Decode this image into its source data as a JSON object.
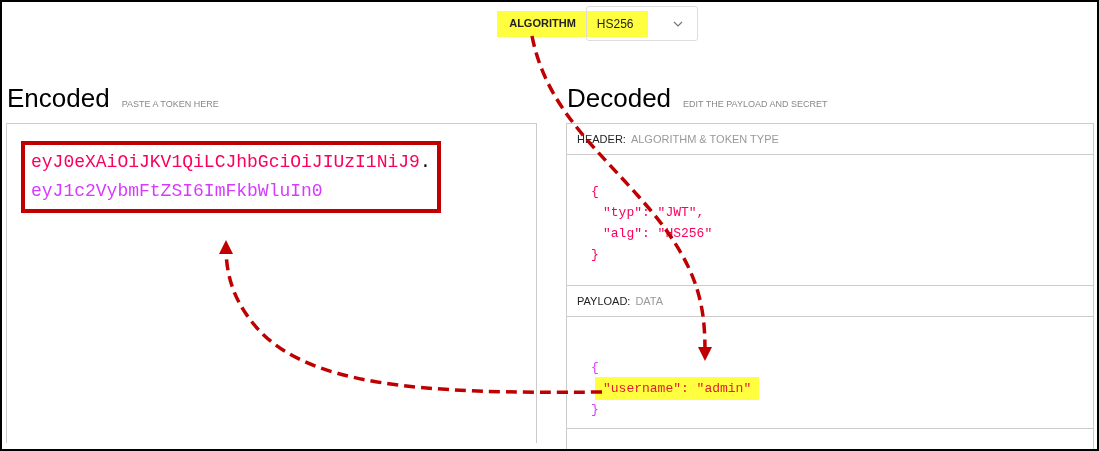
{
  "algorithm": {
    "label": "ALGORITHM",
    "value": "HS256",
    "highlighted": true
  },
  "encoded": {
    "title": "Encoded",
    "hint": "PASTE A TOKEN HERE",
    "boxed": true,
    "token": [
      {
        "text": "eyJ0eXAiOiJKV1QiLCJhbGciOiJIUzI1NiJ9",
        "kind": "header"
      },
      {
        "text": ".",
        "kind": "dot"
      },
      {
        "text": "eyJ1c2VybmFtZSI6ImFkbWluIn0",
        "kind": "payload"
      }
    ]
  },
  "decoded": {
    "title": "Decoded",
    "hint": "EDIT THE PAYLOAD AND SECRET",
    "sections": [
      {
        "label": "HEADER:",
        "hint": "ALGORITHM & TOKEN TYPE",
        "kind": "header",
        "lines": [
          {
            "text": "{",
            "kind": "brace",
            "highlighted": false
          },
          {
            "text": "\"typ\": \"JWT\",",
            "kind": "entry",
            "highlighted": false
          },
          {
            "text": "\"alg\": \"HS256\"",
            "kind": "entry",
            "highlighted": false
          },
          {
            "text": "}",
            "kind": "brace",
            "highlighted": false
          }
        ]
      },
      {
        "label": "PAYLOAD:",
        "hint": "DATA",
        "kind": "payload",
        "lines": [
          {
            "text": "{",
            "kind": "brace",
            "highlighted": false
          },
          {
            "text": "\"username\": \"admin\"",
            "kind": "entry",
            "highlighted": true
          },
          {
            "text": "}",
            "kind": "brace",
            "highlighted": false
          }
        ]
      }
    ]
  }
}
